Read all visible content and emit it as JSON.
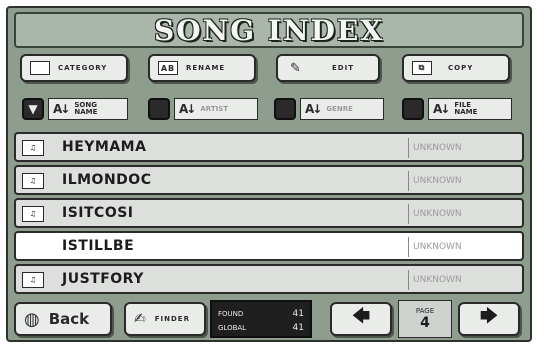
{
  "title": "SONG INDEX",
  "toolbar": {
    "category_label": "CATEGORY",
    "rename_label": "RENAME",
    "edit_label": "EDIT",
    "copy_label": "COPY",
    "rename_icon": "AB"
  },
  "filters": [
    {
      "label_line1": "SONG",
      "label_line2": "NAME"
    },
    {
      "label_line1": "ARTIST",
      "label_line2": ""
    },
    {
      "label_line1": "GENRE",
      "label_line2": ""
    },
    {
      "label_line1": "FILE",
      "label_line2": "NAME"
    }
  ],
  "songs": [
    {
      "name": "HEYMAMA",
      "artist": "UNKNOWN"
    },
    {
      "name": "ILMONDOC",
      "artist": "UNKNOWN"
    },
    {
      "name": "ISITCOSI",
      "artist": "UNKNOWN"
    },
    {
      "name": "ISTILLBE",
      "artist": "UNKNOWN"
    },
    {
      "name": "JUSTFORY",
      "artist": "UNKNOWN"
    }
  ],
  "footer": {
    "back_label": "Back",
    "finder_label": "FINDER",
    "found_label": "FOUND",
    "found_value": "41",
    "global_label": "GLOBAL",
    "global_value": "41",
    "page_label": "PAGE",
    "page_value": "4"
  }
}
